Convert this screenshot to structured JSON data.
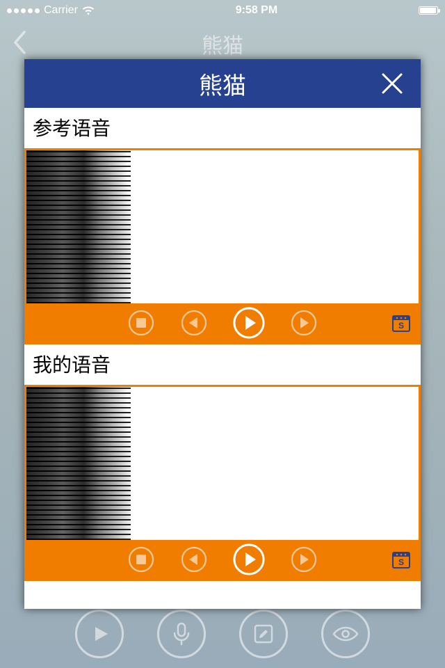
{
  "status": {
    "carrier": "Carrier",
    "time": "9:58 PM"
  },
  "underlying": {
    "title": "熊猫"
  },
  "modal": {
    "title": "熊猫",
    "panels": [
      {
        "label": "参考语音"
      },
      {
        "label": "我的语音"
      }
    ]
  }
}
